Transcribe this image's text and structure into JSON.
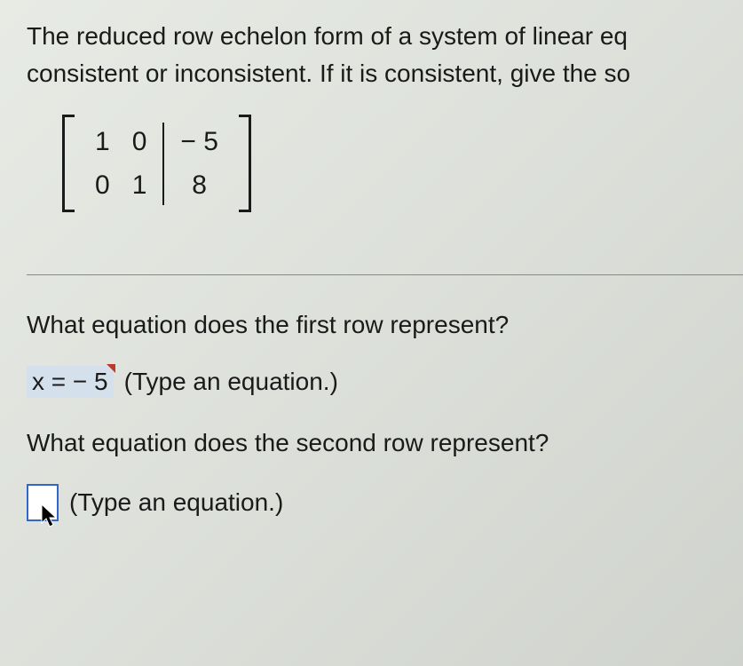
{
  "problem": {
    "line1": "The reduced row echelon form of a system of linear eq",
    "line2": "consistent or inconsistent. If it is consistent, give the so"
  },
  "matrix": {
    "r1c1": "1",
    "r1c2": "0",
    "r1c3": "− 5",
    "r2c1": "0",
    "r2c2": "1",
    "r2c3": "8"
  },
  "question1": "What equation does the first row represent?",
  "answer1": "x = − 5",
  "hint1": "(Type an equation.)",
  "question2": "What equation does the second row represent?",
  "hint2": "(Type an equation.)"
}
